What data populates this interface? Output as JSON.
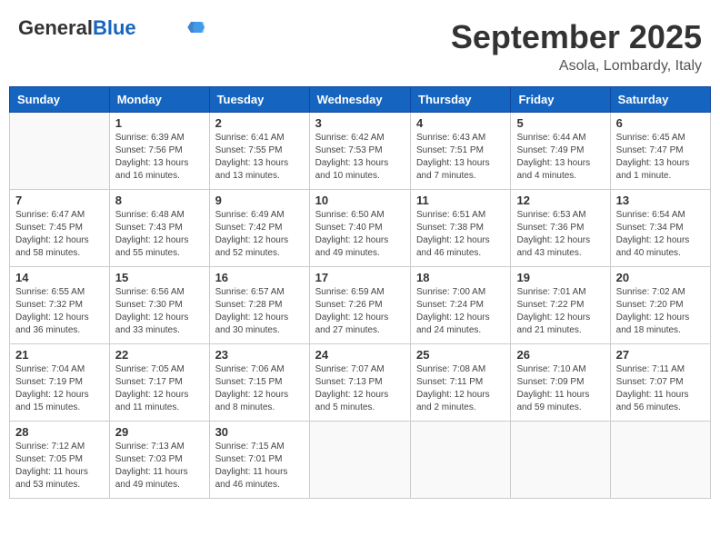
{
  "header": {
    "logo_general": "General",
    "logo_blue": "Blue",
    "month": "September 2025",
    "location": "Asola, Lombardy, Italy"
  },
  "weekdays": [
    "Sunday",
    "Monday",
    "Tuesday",
    "Wednesday",
    "Thursday",
    "Friday",
    "Saturday"
  ],
  "weeks": [
    [
      {
        "day": "",
        "info": ""
      },
      {
        "day": "1",
        "info": "Sunrise: 6:39 AM\nSunset: 7:56 PM\nDaylight: 13 hours\nand 16 minutes."
      },
      {
        "day": "2",
        "info": "Sunrise: 6:41 AM\nSunset: 7:55 PM\nDaylight: 13 hours\nand 13 minutes."
      },
      {
        "day": "3",
        "info": "Sunrise: 6:42 AM\nSunset: 7:53 PM\nDaylight: 13 hours\nand 10 minutes."
      },
      {
        "day": "4",
        "info": "Sunrise: 6:43 AM\nSunset: 7:51 PM\nDaylight: 13 hours\nand 7 minutes."
      },
      {
        "day": "5",
        "info": "Sunrise: 6:44 AM\nSunset: 7:49 PM\nDaylight: 13 hours\nand 4 minutes."
      },
      {
        "day": "6",
        "info": "Sunrise: 6:45 AM\nSunset: 7:47 PM\nDaylight: 13 hours\nand 1 minute."
      }
    ],
    [
      {
        "day": "7",
        "info": "Sunrise: 6:47 AM\nSunset: 7:45 PM\nDaylight: 12 hours\nand 58 minutes."
      },
      {
        "day": "8",
        "info": "Sunrise: 6:48 AM\nSunset: 7:43 PM\nDaylight: 12 hours\nand 55 minutes."
      },
      {
        "day": "9",
        "info": "Sunrise: 6:49 AM\nSunset: 7:42 PM\nDaylight: 12 hours\nand 52 minutes."
      },
      {
        "day": "10",
        "info": "Sunrise: 6:50 AM\nSunset: 7:40 PM\nDaylight: 12 hours\nand 49 minutes."
      },
      {
        "day": "11",
        "info": "Sunrise: 6:51 AM\nSunset: 7:38 PM\nDaylight: 12 hours\nand 46 minutes."
      },
      {
        "day": "12",
        "info": "Sunrise: 6:53 AM\nSunset: 7:36 PM\nDaylight: 12 hours\nand 43 minutes."
      },
      {
        "day": "13",
        "info": "Sunrise: 6:54 AM\nSunset: 7:34 PM\nDaylight: 12 hours\nand 40 minutes."
      }
    ],
    [
      {
        "day": "14",
        "info": "Sunrise: 6:55 AM\nSunset: 7:32 PM\nDaylight: 12 hours\nand 36 minutes."
      },
      {
        "day": "15",
        "info": "Sunrise: 6:56 AM\nSunset: 7:30 PM\nDaylight: 12 hours\nand 33 minutes."
      },
      {
        "day": "16",
        "info": "Sunrise: 6:57 AM\nSunset: 7:28 PM\nDaylight: 12 hours\nand 30 minutes."
      },
      {
        "day": "17",
        "info": "Sunrise: 6:59 AM\nSunset: 7:26 PM\nDaylight: 12 hours\nand 27 minutes."
      },
      {
        "day": "18",
        "info": "Sunrise: 7:00 AM\nSunset: 7:24 PM\nDaylight: 12 hours\nand 24 minutes."
      },
      {
        "day": "19",
        "info": "Sunrise: 7:01 AM\nSunset: 7:22 PM\nDaylight: 12 hours\nand 21 minutes."
      },
      {
        "day": "20",
        "info": "Sunrise: 7:02 AM\nSunset: 7:20 PM\nDaylight: 12 hours\nand 18 minutes."
      }
    ],
    [
      {
        "day": "21",
        "info": "Sunrise: 7:04 AM\nSunset: 7:19 PM\nDaylight: 12 hours\nand 15 minutes."
      },
      {
        "day": "22",
        "info": "Sunrise: 7:05 AM\nSunset: 7:17 PM\nDaylight: 12 hours\nand 11 minutes."
      },
      {
        "day": "23",
        "info": "Sunrise: 7:06 AM\nSunset: 7:15 PM\nDaylight: 12 hours\nand 8 minutes."
      },
      {
        "day": "24",
        "info": "Sunrise: 7:07 AM\nSunset: 7:13 PM\nDaylight: 12 hours\nand 5 minutes."
      },
      {
        "day": "25",
        "info": "Sunrise: 7:08 AM\nSunset: 7:11 PM\nDaylight: 12 hours\nand 2 minutes."
      },
      {
        "day": "26",
        "info": "Sunrise: 7:10 AM\nSunset: 7:09 PM\nDaylight: 11 hours\nand 59 minutes."
      },
      {
        "day": "27",
        "info": "Sunrise: 7:11 AM\nSunset: 7:07 PM\nDaylight: 11 hours\nand 56 minutes."
      }
    ],
    [
      {
        "day": "28",
        "info": "Sunrise: 7:12 AM\nSunset: 7:05 PM\nDaylight: 11 hours\nand 53 minutes."
      },
      {
        "day": "29",
        "info": "Sunrise: 7:13 AM\nSunset: 7:03 PM\nDaylight: 11 hours\nand 49 minutes."
      },
      {
        "day": "30",
        "info": "Sunrise: 7:15 AM\nSunset: 7:01 PM\nDaylight: 11 hours\nand 46 minutes."
      },
      {
        "day": "",
        "info": ""
      },
      {
        "day": "",
        "info": ""
      },
      {
        "day": "",
        "info": ""
      },
      {
        "day": "",
        "info": ""
      }
    ]
  ]
}
